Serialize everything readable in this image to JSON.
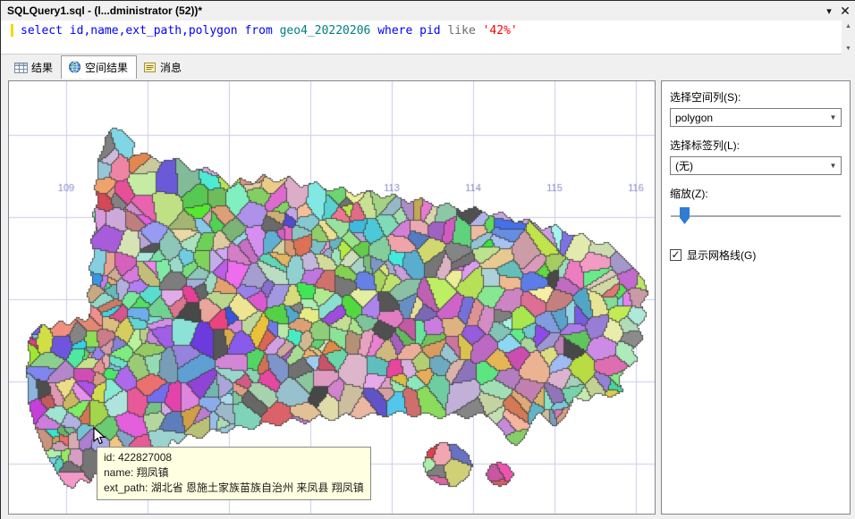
{
  "window": {
    "title": "SQLQuery1.sql - (l...dministrator (52))*"
  },
  "icons": {
    "title_dropdown": "▾",
    "title_close": "✕",
    "scroll_up": "▲",
    "scroll_down": "▼",
    "combo_arrow": "▼",
    "check": "✓"
  },
  "editor": {
    "sql_segments": [
      {
        "text": "select ",
        "color": "#0000ff"
      },
      {
        "text": "id,name,ext_path,polygon ",
        "color": "#0000ff"
      },
      {
        "text": "from ",
        "color": "#0000ff"
      },
      {
        "text": "geo4_20220206 ",
        "color": "#008080"
      },
      {
        "text": "where ",
        "color": "#0000ff"
      },
      {
        "text": "pid ",
        "color": "#0000ff"
      },
      {
        "text": "like ",
        "color": "#6b6b6b"
      },
      {
        "text": "'42%'",
        "color": "#ff0000"
      }
    ]
  },
  "tabs": [
    {
      "label": "结果"
    },
    {
      "label": "空间结果"
    },
    {
      "label": "消息"
    }
  ],
  "spatial": {
    "lon_labels": [
      "109",
      "113",
      "114",
      "115",
      "116"
    ],
    "grid_color": "#ccccec",
    "label_color": "#8888cc",
    "tooltip": {
      "line1": "id: 422827008",
      "line2": "name: 翔凤镇",
      "line3": "ext_path: 湖北省 恩施土家族苗族自治州 来凤县 翔凤镇"
    }
  },
  "options": {
    "spatial_col_label": "选择空间列(S):",
    "spatial_col_value": "polygon",
    "label_col_label": "选择标签列(L):",
    "label_col_value": "(无)",
    "zoom_label": "缩放(Z):",
    "grid_checkbox_label": "显示网格线(G)",
    "grid_checkbox_checked": true
  }
}
